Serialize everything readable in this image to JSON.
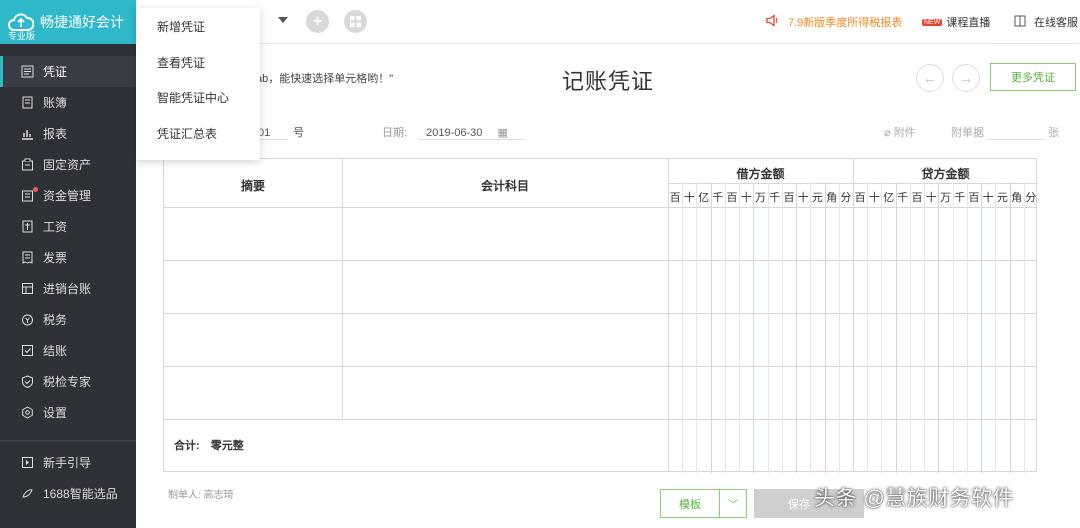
{
  "app": {
    "name": "畅捷通好会计",
    "edition": "专业版"
  },
  "sidebar": {
    "items": [
      {
        "label": "凭证",
        "icon": "voucher-icon"
      },
      {
        "label": "账簿",
        "icon": "ledger-icon"
      },
      {
        "label": "报表",
        "icon": "report-icon"
      },
      {
        "label": "固定资产",
        "icon": "fixed-asset-icon"
      },
      {
        "label": "资金管理",
        "icon": "fund-icon"
      },
      {
        "label": "工资",
        "icon": "salary-icon"
      },
      {
        "label": "发票",
        "icon": "invoice-icon"
      },
      {
        "label": "进销台账",
        "icon": "inventory-icon"
      },
      {
        "label": "税务",
        "icon": "tax-icon"
      },
      {
        "label": "结账",
        "icon": "closing-icon"
      },
      {
        "label": "税检专家",
        "icon": "tax-check-icon"
      },
      {
        "label": "设置",
        "icon": "settings-icon"
      }
    ],
    "bottom_items": [
      {
        "label": "新手引导",
        "icon": "guide-icon"
      },
      {
        "label": "1688智能选品",
        "icon": "shop-icon"
      }
    ]
  },
  "popup_menu": {
    "items": [
      "新增凭证",
      "查看凭证",
      "智能凭证中心",
      "凭证汇总表"
    ]
  },
  "topbar": {
    "promo": "7.9新版季度所得税报表",
    "live_badge": "NEW",
    "live": "课程直播",
    "service": "在线客服"
  },
  "voucher": {
    "tip": "ab，能快速选择单元格哟！\"",
    "title": "记账凭证",
    "more_button": "更多凭证",
    "number_partial": "01",
    "number_suffix": "号",
    "date_label": "日期:",
    "date_value": "2019-06-30",
    "attachment_label": "附件",
    "attach_doc_label": "附单据",
    "attach_unit": "张",
    "columns": {
      "summary": "摘要",
      "subject": "会计科目",
      "debit": "借方金额",
      "credit": "贷方金额"
    },
    "digit_units": [
      "百",
      "十",
      "亿",
      "千",
      "百",
      "十",
      "万",
      "千",
      "百",
      "十",
      "元",
      "角",
      "分"
    ],
    "total_label": "合计:",
    "total_value": "零元整",
    "maker_label": "制单人: 高志琦",
    "template_button": "模板",
    "save_button": "保存"
  },
  "watermark": "头条 @慧族财务软件",
  "colors": {
    "accent": "#2fb8c9",
    "sidebar_bg": "#2f3138",
    "green": "#5ab33a",
    "orange": "#f08a24",
    "debit_line": "#c7d7f0",
    "credit_line": "#f0c7d6"
  }
}
